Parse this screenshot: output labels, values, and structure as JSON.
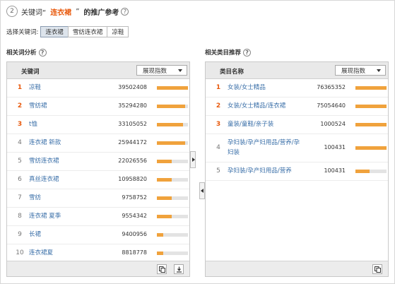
{
  "header": {
    "step": "2",
    "prefix": "关键词“",
    "keyword": "连衣裙",
    "suffix": "”",
    "title_bold": "的推广参考"
  },
  "selector": {
    "label": "选择关键词:",
    "options": [
      "连衣裙",
      "雪纺连衣裙",
      "凉鞋"
    ],
    "active_index": 0
  },
  "left": {
    "title": "相关词分析",
    "column": "关键词",
    "dropdown": "展现指数",
    "rows": [
      {
        "rank": "1",
        "name": "凉鞋",
        "value": "39502408",
        "pct": 1.0
      },
      {
        "rank": "2",
        "name": "雪纺裙",
        "value": "35294280",
        "pct": 0.9
      },
      {
        "rank": "3",
        "name": "t恤",
        "value": "33105052",
        "pct": 0.85
      },
      {
        "rank": "4",
        "name": "连衣裙 新款",
        "value": "25944172",
        "pct": 0.9
      },
      {
        "rank": "5",
        "name": "雪纺连衣裙",
        "value": "22026556",
        "pct": 0.48
      },
      {
        "rank": "6",
        "name": "真丝连衣裙",
        "value": "10958820",
        "pct": 0.48
      },
      {
        "rank": "7",
        "name": "雪纺",
        "value": "9758752",
        "pct": 0.48
      },
      {
        "rank": "8",
        "name": "连衣裙 夏季",
        "value": "9554342",
        "pct": 0.48
      },
      {
        "rank": "9",
        "name": "长裙",
        "value": "9400956",
        "pct": 0.2
      },
      {
        "rank": "10",
        "name": "连衣裙夏",
        "value": "8818778",
        "pct": 0.2
      }
    ]
  },
  "right": {
    "title": "相关类目推荐",
    "column": "类目名称",
    "dropdown": "展现指数",
    "rows": [
      {
        "rank": "1",
        "name": "女装/女士精品",
        "value": "76365352",
        "pct": 1.0
      },
      {
        "rank": "2",
        "name": "女装/女士精品/连衣裙",
        "value": "75054640",
        "pct": 1.0
      },
      {
        "rank": "3",
        "name": "童装/童鞋/亲子装",
        "value": "1000524",
        "pct": 1.0
      },
      {
        "rank": "4",
        "name": "孕妇装/孕产妇用品/营养/孕妇装",
        "name_line1": "孕妇装/孕产妇用品/营养/孕",
        "name_line2": "妇装",
        "value": "100431",
        "pct": 1.0
      },
      {
        "rank": "5",
        "name": "孕妇装/孕产妇用品/营养",
        "value": "100431",
        "pct": 0.45
      }
    ]
  },
  "colors": {
    "accent": "#e8590c",
    "bar_fill": "#f0a23c",
    "link": "#3a6fa8"
  },
  "icons": {
    "copy": "copy-icon",
    "download": "download-icon",
    "expand_right": "triangle-right-icon",
    "collapse_left": "triangle-left-icon"
  }
}
